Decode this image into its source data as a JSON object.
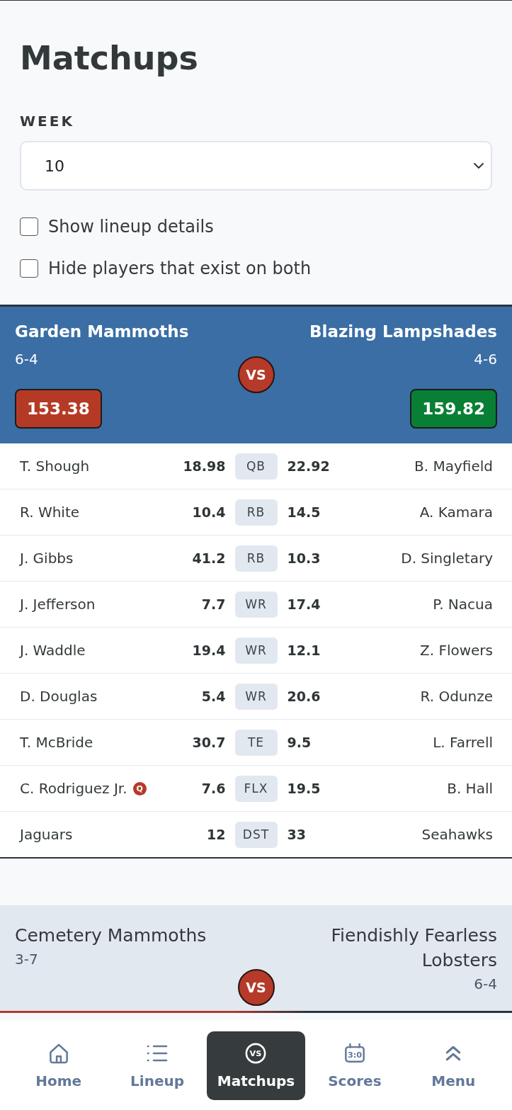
{
  "page": {
    "title": "Matchups"
  },
  "week": {
    "label": "WEEK",
    "value": "10"
  },
  "options": [
    {
      "label": "Show lineup details",
      "checked": false
    },
    {
      "label": "Hide players that exist on both",
      "checked": false
    }
  ],
  "matchups": [
    {
      "highlighted": true,
      "vs": "VS",
      "home": {
        "name": "Garden Mammoths",
        "record": "6-4",
        "score": "153.38",
        "leading": false
      },
      "away": {
        "name": "Blazing Lampshades",
        "record": "4-6",
        "score": "159.82",
        "leading": true
      },
      "rows": [
        {
          "position": "QB",
          "home": {
            "name": "T. Shough",
            "points": "18.98"
          },
          "away": {
            "name": "B. Mayfield",
            "points": "22.92"
          }
        },
        {
          "position": "RB",
          "home": {
            "name": "R. White",
            "points": "10.4"
          },
          "away": {
            "name": "A. Kamara",
            "points": "14.5"
          }
        },
        {
          "position": "RB",
          "home": {
            "name": "J. Gibbs",
            "points": "41.2"
          },
          "away": {
            "name": "D. Singletary",
            "points": "10.3"
          }
        },
        {
          "position": "WR",
          "home": {
            "name": "J. Jefferson",
            "points": "7.7"
          },
          "away": {
            "name": "P. Nacua",
            "points": "17.4"
          }
        },
        {
          "position": "WR",
          "home": {
            "name": "J. Waddle",
            "points": "19.4"
          },
          "away": {
            "name": "Z. Flowers",
            "points": "12.1"
          }
        },
        {
          "position": "WR",
          "home": {
            "name": "D. Douglas",
            "points": "5.4"
          },
          "away": {
            "name": "R. Odunze",
            "points": "20.6"
          }
        },
        {
          "position": "TE",
          "home": {
            "name": "T. McBride",
            "points": "30.7"
          },
          "away": {
            "name": "L. Farrell",
            "points": "9.5"
          }
        },
        {
          "position": "FLX",
          "home": {
            "name": "C. Rodriguez Jr.",
            "points": "7.6",
            "status": "Q"
          },
          "away": {
            "name": "B. Hall",
            "points": "19.5"
          }
        },
        {
          "position": "DST",
          "home": {
            "name": "Jaguars",
            "points": "12"
          },
          "away": {
            "name": "Seahawks",
            "points": "33"
          }
        }
      ]
    },
    {
      "highlighted": false,
      "vs": "VS",
      "home": {
        "name": "Cemetery Mammoths",
        "record": "3-7"
      },
      "away": {
        "name": "Fiendishly Fearless Lobsters",
        "record": "6-4"
      }
    }
  ],
  "nav": [
    {
      "label": "Home",
      "selected": false
    },
    {
      "label": "Lineup",
      "selected": false
    },
    {
      "label": "Matchups",
      "selected": true,
      "icon_text": "VS"
    },
    {
      "label": "Scores",
      "selected": false,
      "icon_text": "3:0"
    },
    {
      "label": "Menu",
      "selected": false
    }
  ]
}
